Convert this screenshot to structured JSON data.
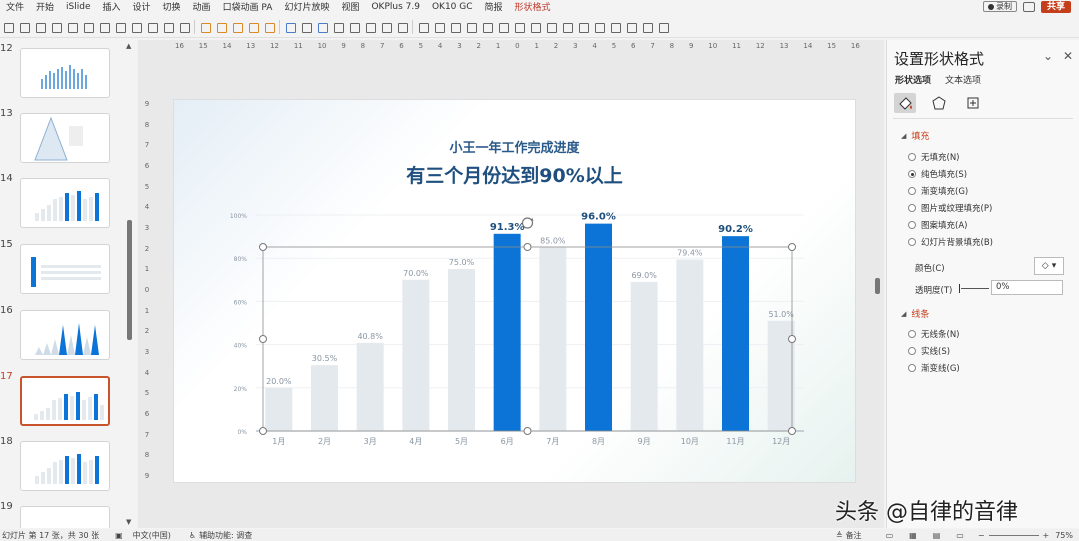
{
  "menu": {
    "items": [
      "文件",
      "开始",
      "iSlide",
      "插入",
      "设计",
      "切换",
      "动画",
      "口袋动画 PA",
      "幻灯片放映",
      "视图",
      "OKPlus 7.9",
      "OK10 GC",
      "简报",
      "形状格式"
    ],
    "active_index": 13,
    "record_label": "录制",
    "share_label": "共享"
  },
  "toolbar": {
    "zoom_label": "75%"
  },
  "thumbnails": {
    "numbers": [
      "12",
      "13",
      "14",
      "15",
      "16",
      "17",
      "18",
      "19"
    ],
    "active": "17"
  },
  "ruler": {
    "h_ticks": [
      "16",
      "15",
      "14",
      "13",
      "12",
      "11",
      "10",
      "9",
      "8",
      "7",
      "6",
      "5",
      "4",
      "3",
      "2",
      "1",
      "0",
      "1",
      "2",
      "3",
      "4",
      "5",
      "6",
      "7",
      "8",
      "9",
      "10",
      "11",
      "12",
      "13",
      "14",
      "15",
      "16"
    ],
    "v_ticks": [
      "9",
      "8",
      "7",
      "6",
      "5",
      "4",
      "3",
      "2",
      "1",
      "0",
      "1",
      "2",
      "3",
      "4",
      "5",
      "6",
      "7",
      "8",
      "9"
    ]
  },
  "slide": {
    "subtitle": "小王一年工作完成进度",
    "title": "有三个月份达到90%以上"
  },
  "chart_data": {
    "type": "bar",
    "categories": [
      "1月",
      "2月",
      "3月",
      "4月",
      "5月",
      "6月",
      "7月",
      "8月",
      "9月",
      "10月",
      "11月",
      "12月"
    ],
    "values": [
      20.0,
      30.5,
      40.8,
      70.0,
      75.0,
      91.3,
      85.0,
      96.0,
      69.0,
      79.4,
      90.2,
      51.0
    ],
    "data_labels": [
      "20.0%",
      "30.5%",
      "40.8%",
      "70.0%",
      "75.0%",
      "91.3%",
      "85.0%",
      "96.0%",
      "69.0%",
      "79.4%",
      "90.2%",
      "51.0%"
    ],
    "highlight": [
      false,
      false,
      false,
      false,
      false,
      true,
      false,
      true,
      false,
      false,
      true,
      false
    ],
    "y_ticks": [
      "0%",
      "20%",
      "40%",
      "60%",
      "80%",
      "100%"
    ],
    "ylim": [
      0,
      100
    ],
    "colors": {
      "normal": "#e4e9ee",
      "highlight": "#0b74d6"
    },
    "grid": true
  },
  "pane": {
    "title": "设置形状格式",
    "tabs": [
      "形状选项",
      "文本选项"
    ],
    "fill_section": "填充",
    "fill_options": [
      "无填充(N)",
      "纯色填充(S)",
      "渐变填充(G)",
      "图片或纹理填充(P)",
      "图案填充(A)",
      "幻灯片背景填充(B)"
    ],
    "fill_selected": 1,
    "color_label": "颜色(C)",
    "transparency_label": "透明度(T)",
    "transparency_value": "0%",
    "line_section": "线条",
    "line_options": [
      "无线条(N)",
      "实线(S)",
      "渐变线(G)"
    ]
  },
  "status": {
    "slide_info": "幻灯片 第 17 张，共 30 张",
    "language": "中文(中国)",
    "accessibility": "辅助功能: 调查",
    "notes": "备注",
    "zoom": "75%"
  },
  "watermark": "头条 @自律的音律"
}
